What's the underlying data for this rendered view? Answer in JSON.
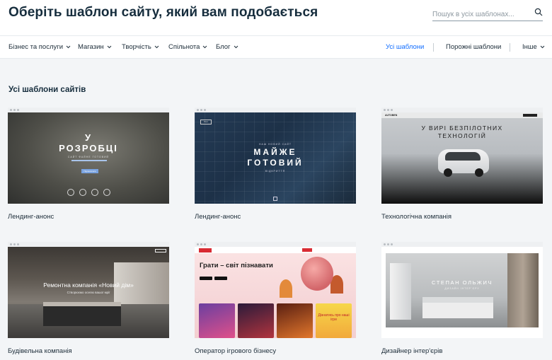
{
  "header": {
    "title": "Оберіть шаблон сайту, який вам подобається",
    "search_placeholder": "Пошук в усіх шаблонах...",
    "search_icon": "search-icon"
  },
  "nav": {
    "categories": [
      {
        "label": "Бізнес та послуги",
        "dropdown": true
      },
      {
        "label": "Магазин",
        "dropdown": true
      },
      {
        "label": "Творчість",
        "dropdown": true
      },
      {
        "label": "Спільнота",
        "dropdown": true
      },
      {
        "label": "Блог",
        "dropdown": true
      }
    ],
    "right": [
      {
        "label": "Усі шаблони",
        "active": true
      },
      {
        "label": "Порожні шаблони",
        "active": false
      },
      {
        "label": "Інше",
        "dropdown": true
      }
    ],
    "active_color": "#116dff"
  },
  "section_title": "Усі шаблони сайтів",
  "templates": [
    {
      "label": "Лендинг-анонс",
      "preview": {
        "line1": "У",
        "line2": "РОЗРОБЦІ",
        "tagline": "САЙТ ФАЙНЕ ГОТОВИЙ",
        "button": "Підписатися"
      }
    },
    {
      "label": "Лендинг-анонс",
      "preview": {
        "small": "НАШ НОВИЙ САЙТ",
        "line1": "МАЙЖЕ",
        "line2": "ГОТОВИЙ",
        "tagline": "ВІДКРИТТЯ",
        "logo": "Лого"
      }
    },
    {
      "label": "Технологічна компанія",
      "preview": {
        "line1": "У ВИРІ БЕЗПІЛОТНИХ",
        "line2": "ТЕХНОЛОГІЙ",
        "brand": "AUTOBEN"
      }
    },
    {
      "label": "Будівельна компанія",
      "preview": {
        "headline": "Ремонтна компанія «Новий дім»",
        "subline": "Створюємо оселю вашої мрії"
      }
    },
    {
      "label": "Оператор ігрового бізнесу",
      "preview": {
        "headline": "Грати – світ пізнавати",
        "tile_text": "Дізнатись про наші ігри"
      }
    },
    {
      "label": "Дизайнер інтер'єрів",
      "preview": {
        "headline": "СТЕПАН ОЛЬЖИЧ",
        "subline": "ДИЗАЙН ІНТЕР'ЄРУ"
      }
    }
  ]
}
